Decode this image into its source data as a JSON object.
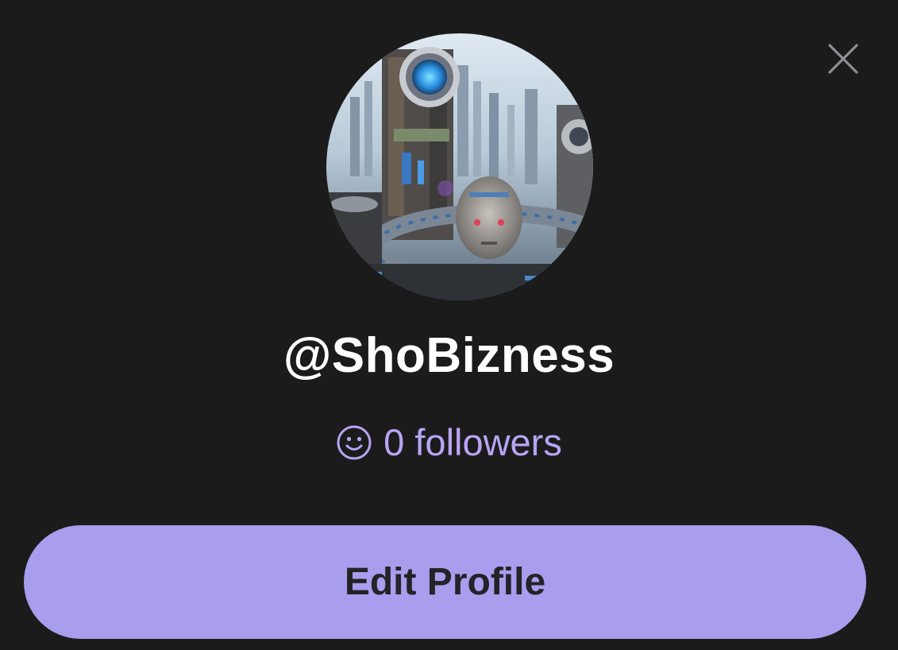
{
  "profile": {
    "username": "@ShoBizness",
    "followers_label": "0 followers",
    "avatar_alt": "profile avatar"
  },
  "actions": {
    "edit_profile_label": "Edit Profile",
    "close_icon": "close-icon"
  },
  "icons": {
    "followers_icon": "smiley-face-icon"
  },
  "colors": {
    "background": "#1b1b1c",
    "accent": "#a99ded",
    "followers_text": "#b8a4f3",
    "username_text": "#ffffff",
    "button_text": "#242328"
  }
}
